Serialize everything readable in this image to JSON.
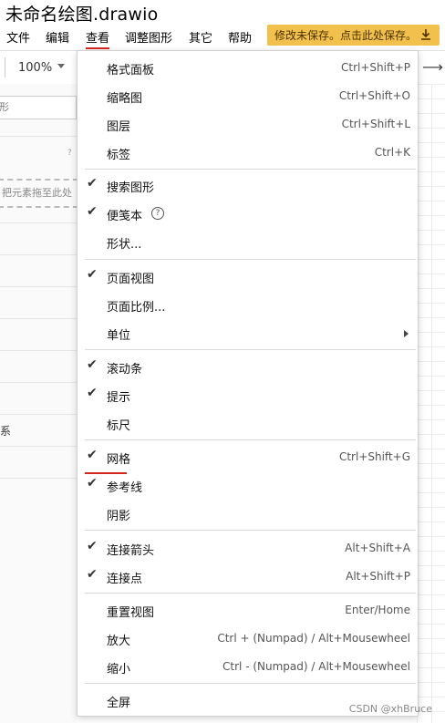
{
  "window": {
    "title": "未命名绘图.drawio"
  },
  "menubar": {
    "items": [
      "文件",
      "编辑",
      "查看",
      "调整图形",
      "其它",
      "帮助"
    ],
    "save_banner": "修改未保存。点击此处保存。"
  },
  "toolbar": {
    "zoom": "100%"
  },
  "sidebar": {
    "search_placeholder": "形",
    "help_mark": "?",
    "drop_hint": "把元素拖至此处",
    "partial_text": "系"
  },
  "view_menu": {
    "groups": [
      [
        {
          "label": "格式面板",
          "shortcut": "Ctrl+Shift+P",
          "checked": false
        },
        {
          "label": "缩略图",
          "shortcut": "Ctrl+Shift+O",
          "checked": false
        },
        {
          "label": "图层",
          "shortcut": "Ctrl+Shift+L",
          "checked": false
        },
        {
          "label": "标签",
          "shortcut": "Ctrl+K",
          "checked": false
        }
      ],
      [
        {
          "label": "搜索图形",
          "shortcut": "",
          "checked": true
        },
        {
          "label": "便笺本",
          "shortcut": "",
          "checked": true,
          "help": true
        },
        {
          "label": "形状...",
          "shortcut": "",
          "checked": false
        }
      ],
      [
        {
          "label": "页面视图",
          "shortcut": "",
          "checked": true
        },
        {
          "label": "页面比例...",
          "shortcut": "",
          "checked": false
        },
        {
          "label": "单位",
          "shortcut": "",
          "checked": false,
          "submenu": true
        }
      ],
      [
        {
          "label": "滚动条",
          "shortcut": "",
          "checked": true
        },
        {
          "label": "提示",
          "shortcut": "",
          "checked": true
        },
        {
          "label": "标尺",
          "shortcut": "",
          "checked": false
        }
      ],
      [
        {
          "label": "网格",
          "shortcut": "Ctrl+Shift+G",
          "checked": true
        },
        {
          "label": "参考线",
          "shortcut": "",
          "checked": true
        },
        {
          "label": "阴影",
          "shortcut": "",
          "checked": false
        }
      ],
      [
        {
          "label": "连接箭头",
          "shortcut": "Alt+Shift+A",
          "checked": true
        },
        {
          "label": "连接点",
          "shortcut": "Alt+Shift+P",
          "checked": true
        }
      ],
      [
        {
          "label": "重置视图",
          "shortcut": "Enter/Home",
          "checked": false
        },
        {
          "label": "放大",
          "shortcut": "Ctrl + (Numpad) / Alt+Mousewheel",
          "checked": false
        },
        {
          "label": "缩小",
          "shortcut": "Ctrl - (Numpad) / Alt+Mousewheel",
          "checked": false
        }
      ],
      [
        {
          "label": "全屏",
          "shortcut": "",
          "checked": false
        }
      ]
    ]
  },
  "watermark": "CSDN @xhBruce",
  "colors": {
    "accent_red": "#d7261e",
    "banner": "#f2c04c"
  },
  "icons": {
    "check": "check-icon",
    "download": "download-icon",
    "help": "help-circle-icon",
    "submenu": "chevron-right-icon"
  }
}
